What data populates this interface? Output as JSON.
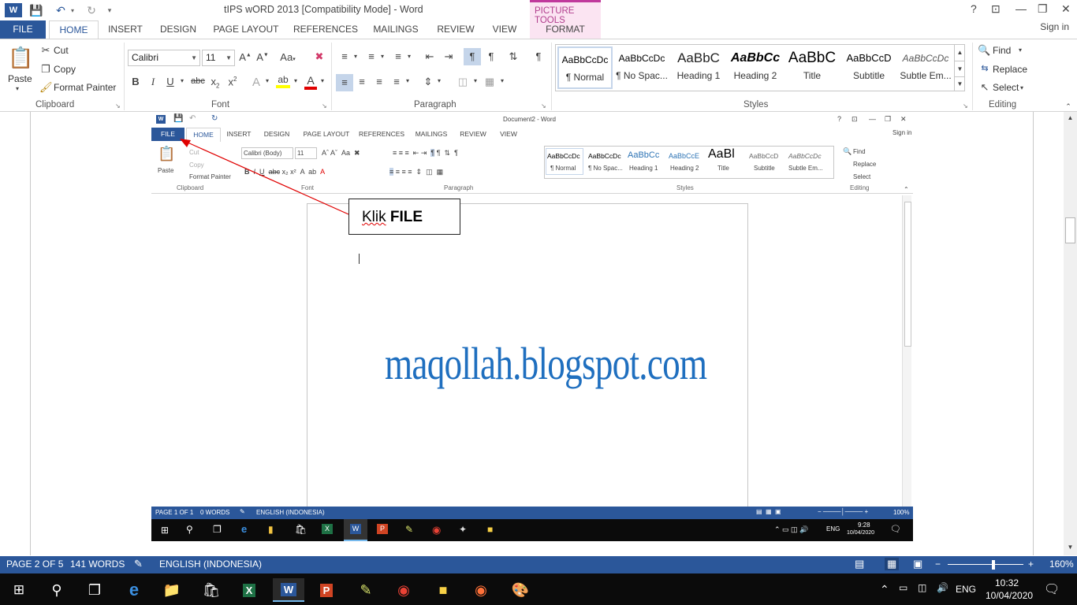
{
  "window": {
    "title": "tIPS wORD 2013 [Compatibility Mode] - Word",
    "contextual_group": "PICTURE TOOLS",
    "help": "?",
    "ribbon_display": "⊡",
    "minimize": "—",
    "restore": "❐",
    "close": "✕",
    "signin": "Sign in"
  },
  "tabs": [
    "FILE",
    "HOME",
    "INSERT",
    "DESIGN",
    "PAGE LAYOUT",
    "REFERENCES",
    "MAILINGS",
    "REVIEW",
    "VIEW",
    "FORMAT"
  ],
  "ribbon": {
    "clipboard": {
      "paste": "Paste",
      "cut": "Cut",
      "copy": "Copy",
      "format_painter": "Format Painter",
      "label": "Clipboard"
    },
    "font": {
      "name": "Calibri",
      "size": "11",
      "label": "Font"
    },
    "paragraph": {
      "label": "Paragraph"
    },
    "styles": {
      "label": "Styles",
      "items": [
        {
          "preview": "AaBbCcDc",
          "name": "¶ Normal"
        },
        {
          "preview": "AaBbCcDc",
          "name": "¶ No Spac..."
        },
        {
          "preview": "AaBbC",
          "name": "Heading 1"
        },
        {
          "preview": "AaBbCc",
          "name": "Heading 2"
        },
        {
          "preview": "AaBbC",
          "name": "Title"
        },
        {
          "preview": "AaBbCcD",
          "name": "Subtitle"
        },
        {
          "preview": "AaBbCcDc",
          "name": "Subtle Em..."
        }
      ]
    },
    "editing": {
      "find": "Find",
      "replace": "Replace",
      "select": "Select",
      "label": "Editing"
    }
  },
  "inner_screenshot": {
    "title": "Document2 - Word",
    "signin": "Sign in",
    "tabs": [
      "FILE",
      "HOME",
      "INSERT",
      "DESIGN",
      "PAGE LAYOUT",
      "REFERENCES",
      "MAILINGS",
      "REVIEW",
      "VIEW"
    ],
    "font_name": "Calibri (Body)",
    "font_size": "11",
    "paste": "Paste",
    "cut": "Cut",
    "copy": "Copy",
    "format_painter": "Format Painter",
    "group_labels": [
      "Clipboard",
      "Font",
      "Paragraph",
      "Styles",
      "Editing"
    ],
    "styles": [
      {
        "preview": "AaBbCcDc",
        "name": "¶ Normal"
      },
      {
        "preview": "AaBbCcDc",
        "name": "¶ No Spac..."
      },
      {
        "preview": "AaBbCc",
        "name": "Heading 1"
      },
      {
        "preview": "AaBbCcE",
        "name": "Heading 2"
      },
      {
        "preview": "AaBl",
        "name": "Title"
      },
      {
        "preview": "AaBbCcD",
        "name": "Subtitle"
      },
      {
        "preview": "AaBbCcDc",
        "name": "Subtle Em..."
      }
    ],
    "find": "Find",
    "replace": "Replace",
    "select": "Select",
    "status": {
      "page": "PAGE 1 OF 1",
      "words": "0 WORDS",
      "language": "ENGLISH (INDONESIA)",
      "zoom": "100%"
    },
    "clock": {
      "time": "9:28",
      "date": "10/04/2020",
      "lang": "ENG"
    }
  },
  "annotation": {
    "prefix": "Klik",
    "bold": "FILE"
  },
  "watermark": "maqollah.blogspot.com",
  "status": {
    "page": "PAGE 2 OF 5",
    "words": "141 WORDS",
    "language": "ENGLISH (INDONESIA)",
    "zoom": "160%"
  },
  "taskbar": {
    "lang": "ENG",
    "time": "10:32",
    "date": "10/04/2020"
  },
  "colors": {
    "accent": "#2b579a",
    "picture_tools": "#c0399c",
    "watermark": "#1f6fbf",
    "arrow": "#e00000"
  }
}
